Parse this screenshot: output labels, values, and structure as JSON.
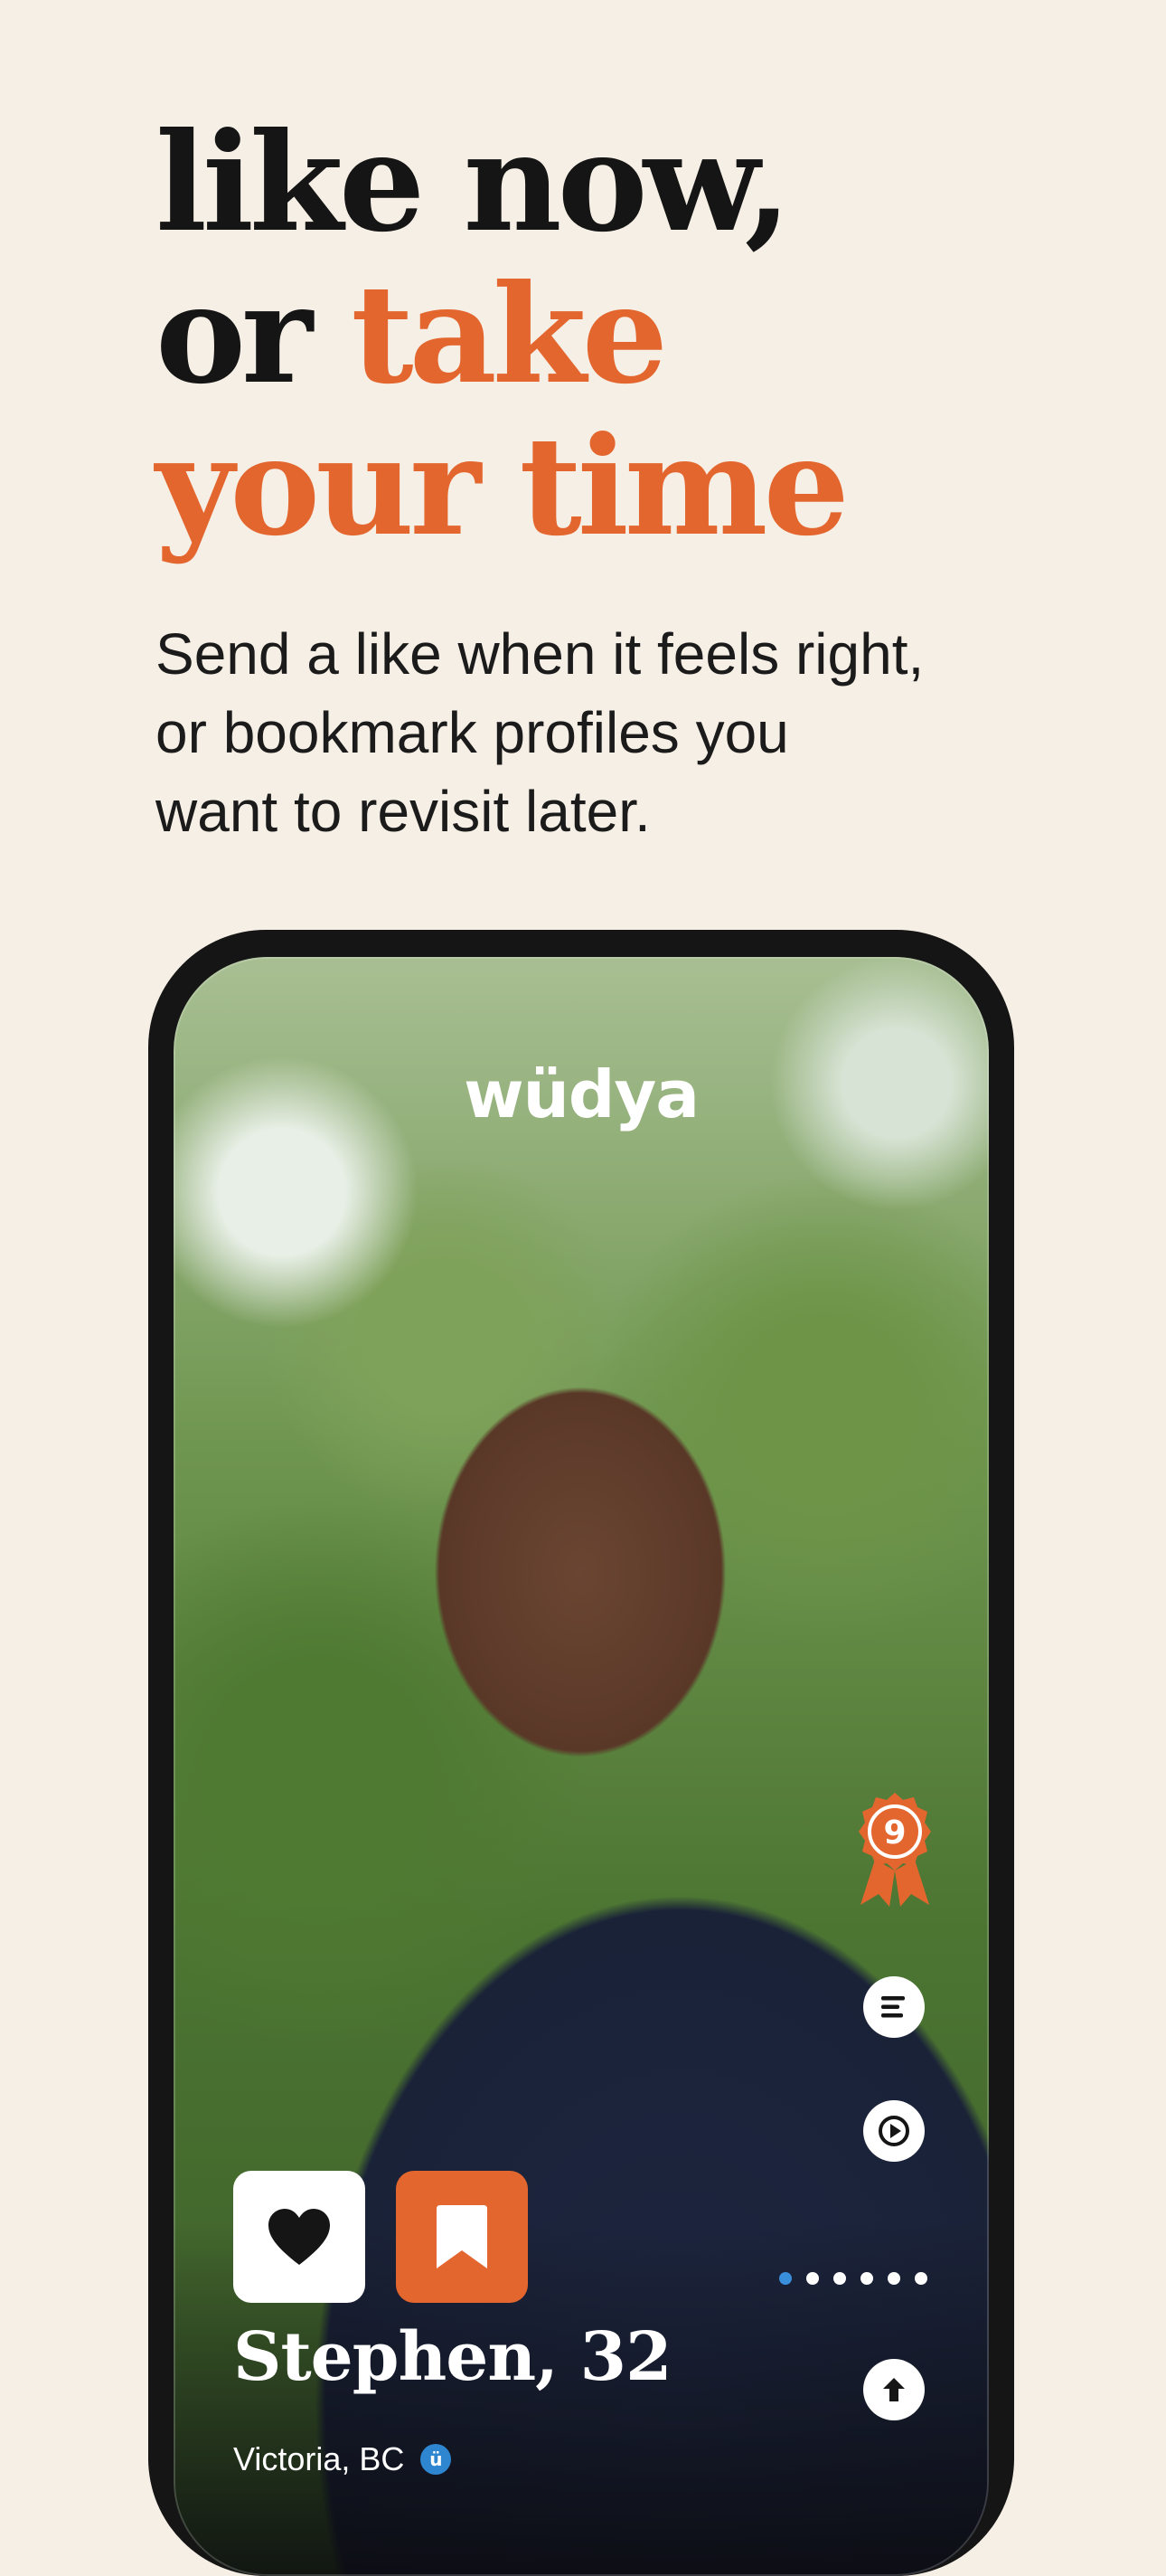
{
  "headline": {
    "line1": "like now,",
    "line2_plain": "or ",
    "line2_accent": "take",
    "line3_accent": "your time"
  },
  "subtitle": {
    "line1": "Send a like when it feels right,",
    "line2": "or bookmark profiles you",
    "line3": "want to revisit later."
  },
  "app": {
    "logo_text": "wüdya",
    "badge_count": "9",
    "profile_name": "Stephen, 32",
    "location": "Victoria, BC",
    "verified_glyph": "ü",
    "photo_count": 6,
    "active_photo_index": 0
  },
  "icons": {
    "badge": "ribbon-badge-icon",
    "bio": "text-lines-icon",
    "video": "play-icon",
    "like": "heart-icon",
    "bookmark": "bookmark-icon",
    "expand": "arrow-up-icon"
  },
  "colors": {
    "background": "#f6efe5",
    "accent": "#e4662f",
    "text": "#151515",
    "verified": "#2f86d0"
  }
}
